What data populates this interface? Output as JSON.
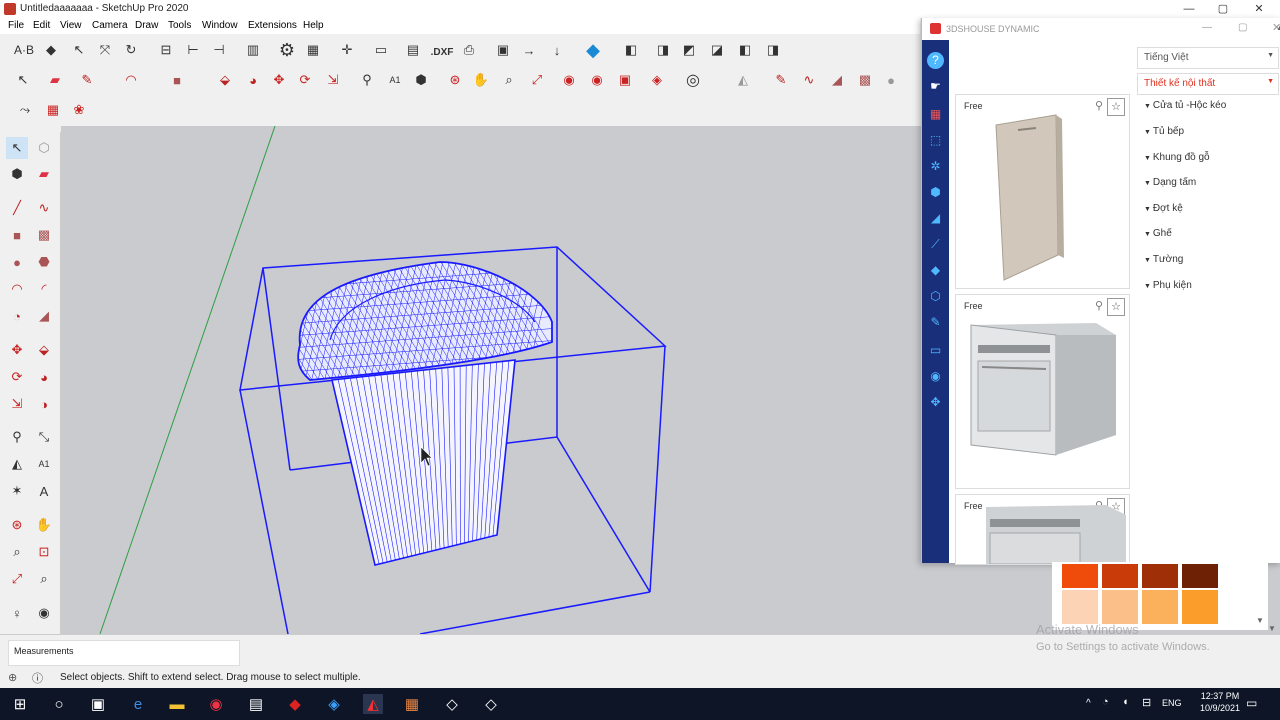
{
  "window": {
    "title": "Untitledaaaaaaa - SketchUp Pro 2020"
  },
  "menu": [
    "File",
    "Edit",
    "View",
    "Camera",
    "Draw",
    "Tools",
    "Window",
    "Extensions",
    "Help"
  ],
  "toolbar": {
    "text_tool": "A·B",
    "dxf_label": ".DXF"
  },
  "status": {
    "measurements_label": "Measurements",
    "hint": "Select objects. Shift to extend select. Drag mouse to select multiple."
  },
  "plugin": {
    "title": "3DSHOUSE DYNAMIC",
    "language": "Tiếng Việt",
    "category": "Thiết kế nội thất",
    "categories": [
      "Cửa tủ -Hộc kéo",
      "Tủ bếp",
      "Khung đồ gỗ",
      "Dạng tấm",
      "Đợt kệ",
      "Ghế",
      "Tường",
      "Phụ kiện"
    ],
    "cards": [
      {
        "badge": "Free"
      },
      {
        "badge": "Free"
      },
      {
        "badge": "Free"
      }
    ]
  },
  "watermark": {
    "line1": "Activate Windows",
    "line2": "Go to Settings to activate Windows."
  },
  "tray": {
    "lang": "ENG",
    "time": "12:37 PM",
    "date": "10/9/2021"
  },
  "colors": {
    "wire": "#1a1aff",
    "accent_red": "#e0301e",
    "plugin_sidebar": "#1a2f7a",
    "taskbar": "#0d1526"
  }
}
